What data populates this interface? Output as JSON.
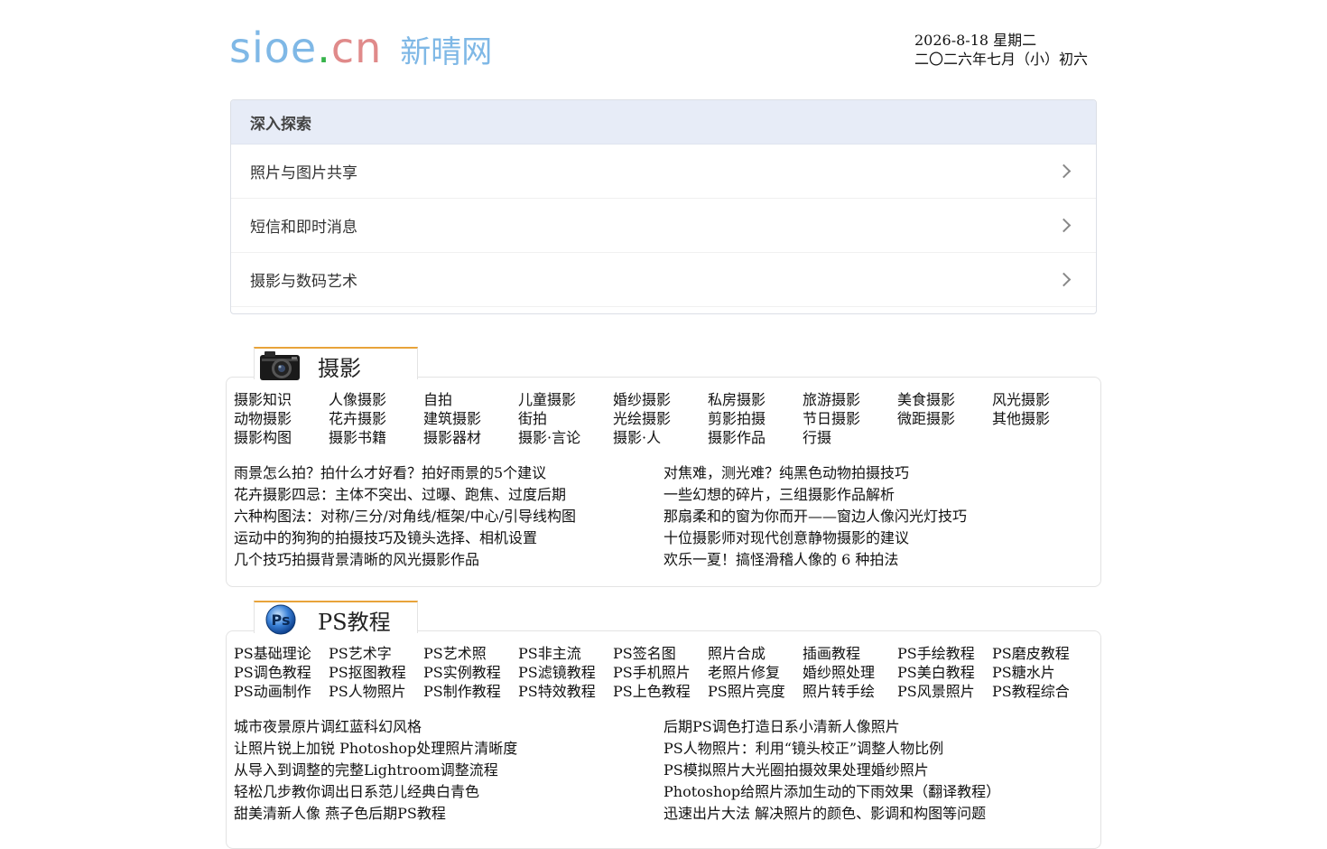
{
  "site": {
    "logo_part1": "sioe",
    "logo_dot": ".",
    "logo_part2": "cn",
    "logo_cn": "新晴网",
    "date_line1": "2026-8-18 星期二",
    "date_line2": "二〇二六年七月（小）初六"
  },
  "explore": {
    "heading": "深入探索",
    "items": [
      {
        "label": "照片与图片共享"
      },
      {
        "label": "短信和即时消息"
      },
      {
        "label": "摄影与数码艺术"
      }
    ]
  },
  "sections": [
    {
      "title": "摄影",
      "icon": "camera-icon",
      "categories": [
        "摄影知识",
        "人像摄影",
        "自拍",
        "儿童摄影",
        "婚纱摄影",
        "私房摄影",
        "旅游摄影",
        "美食摄影",
        "风光摄影",
        "动物摄影",
        "花卉摄影",
        "建筑摄影",
        "街拍",
        "光绘摄影",
        "剪影拍摄",
        "节日摄影",
        "微距摄影",
        "其他摄影",
        "摄影构图",
        "摄影书籍",
        "摄影器材",
        "摄影·言论",
        "摄影·人",
        "摄影作品",
        "行摄"
      ],
      "articles": [
        "雨景怎么拍？拍什么才好看？拍好雨景的5个建议",
        "对焦难，测光难？纯黑色动物拍摄技巧",
        "花卉摄影四忌：主体不突出、过曝、跑焦、过度后期",
        "一些幻想的碎片，三组摄影作品解析",
        "六种构图法：对称/三分/对角线/框架/中心/引导线构图",
        "那扇柔和的窗为你而开——窗边人像闪光灯技巧",
        "运动中的狗狗的拍摄技巧及镜头选择、相机设置",
        "十位摄影师对现代创意静物摄影的建议",
        "几个技巧拍摄背景清晰的风光摄影作品",
        "欢乐一夏！搞怪滑稽人像的 6 种拍法"
      ]
    },
    {
      "title": "PS教程",
      "icon": "photoshop-icon",
      "icon_text": "Ps",
      "categories": [
        "PS基础理论",
        "PS艺术字",
        "PS艺术照",
        "PS非主流",
        "PS签名图",
        "照片合成",
        "插画教程",
        "PS手绘教程",
        "PS磨皮教程",
        "PS调色教程",
        "PS抠图教程",
        "PS实例教程",
        "PS滤镜教程",
        "PS手机照片",
        "老照片修复",
        "婚纱照处理",
        "PS美白教程",
        "PS糖水片",
        "PS动画制作",
        "PS人物照片",
        "PS制作教程",
        "PS特效教程",
        "PS上色教程",
        "PS照片亮度",
        "照片转手绘",
        "PS风景照片",
        "PS教程综合"
      ],
      "articles": [
        "城市夜景原片调红蓝科幻风格",
        "后期PS调色打造日系小清新人像照片",
        "让照片锐上加锐 Photoshop处理照片清晰度",
        "PS人物照片：利用“镜头校正”调整人物比例",
        "从导入到调整的完整Lightroom调整流程",
        "PS模拟照片大光圈拍摄效果处理婚纱照片",
        "轻松几步教你调出日系范儿经典白青色",
        "Photoshop给照片添加生动的下雨效果（翻译教程）",
        "甜美清新人像 燕子色后期PS教程",
        "迅速出片大法 解决照片的颜色、影调和构图等问题"
      ]
    }
  ]
}
